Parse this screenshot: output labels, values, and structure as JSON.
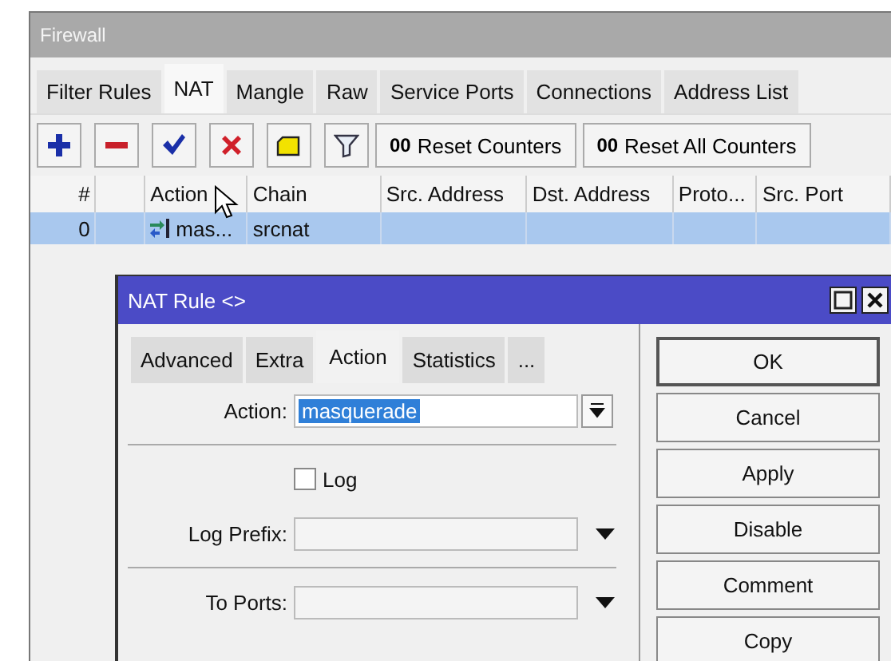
{
  "window": {
    "title": "Firewall"
  },
  "tabs": [
    {
      "label": "Filter Rules",
      "selected": false
    },
    {
      "label": "NAT",
      "selected": true
    },
    {
      "label": "Mangle",
      "selected": false
    },
    {
      "label": "Raw",
      "selected": false
    },
    {
      "label": "Service Ports",
      "selected": false
    },
    {
      "label": "Connections",
      "selected": false
    },
    {
      "label": "Address List",
      "selected": false
    }
  ],
  "toolbar": {
    "icons": [
      {
        "kind": "add"
      },
      {
        "kind": "remove"
      },
      {
        "kind": "enable"
      },
      {
        "kind": "disable"
      },
      {
        "kind": "comment"
      },
      {
        "kind": "filter"
      }
    ],
    "buttons": [
      {
        "prefix": "00",
        "label": "Reset Counters"
      },
      {
        "prefix": "00",
        "label": "Reset All Counters"
      }
    ]
  },
  "table": {
    "columns": [
      "#",
      "Action",
      "Chain",
      "Src. Address",
      "Dst. Address",
      "Proto...",
      "Src. Port"
    ],
    "rows": [
      {
        "number": "0",
        "action": "mas...",
        "chain": "srcnat",
        "selected": true
      }
    ]
  },
  "dialog": {
    "title": "NAT Rule <>",
    "tabs": [
      {
        "label": "Advanced",
        "selected": false
      },
      {
        "label": "Extra",
        "selected": false
      },
      {
        "label": "Action",
        "selected": true
      },
      {
        "label": "Statistics",
        "selected": false
      },
      {
        "label": "...",
        "selected": false
      }
    ],
    "fields": [
      {
        "kind": "select",
        "label": "Action:",
        "value": "masquerade"
      },
      {
        "kind": "separator"
      },
      {
        "kind": "checkbox",
        "label": "Log",
        "checked": false
      },
      {
        "kind": "combo",
        "label": "Log Prefix:"
      },
      {
        "kind": "separator"
      },
      {
        "kind": "combo",
        "label": "To Ports:"
      }
    ],
    "buttons": [
      "OK",
      "Cancel",
      "Apply",
      "Disable",
      "Comment",
      "Copy"
    ]
  }
}
